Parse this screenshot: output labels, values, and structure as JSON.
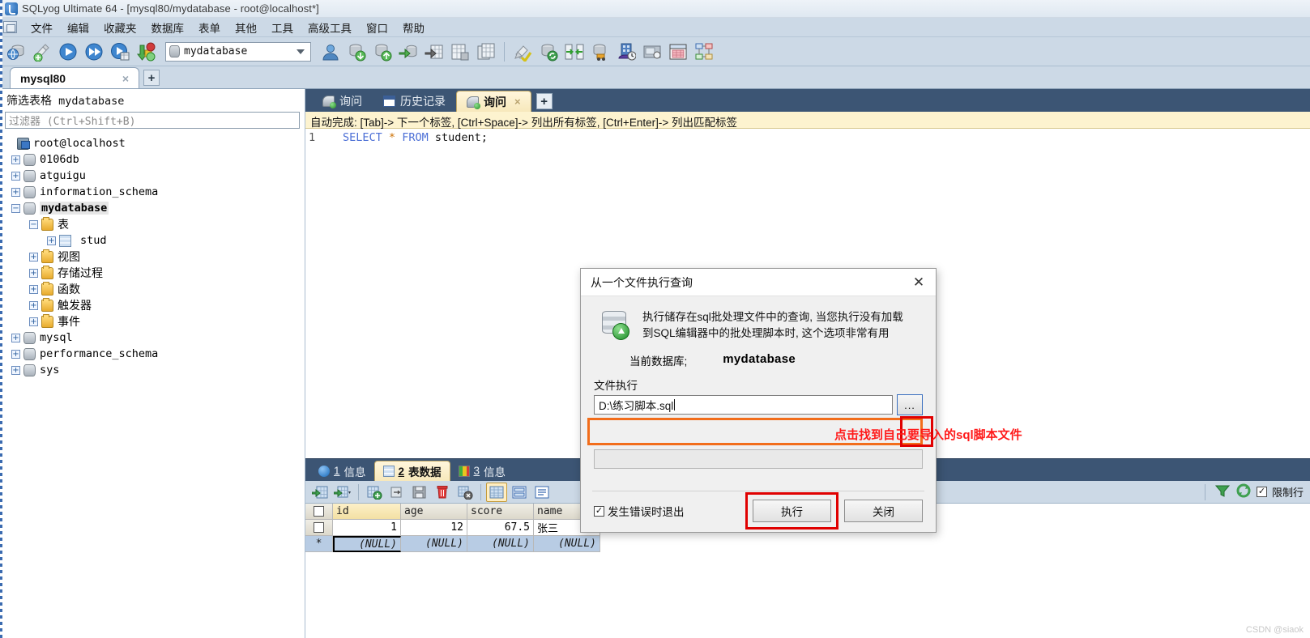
{
  "window": {
    "title": "SQLyog Ultimate 64 - [mysql80/mydatabase - root@localhost*]",
    "icon": "sqlyog-logo-icon"
  },
  "menubar": {
    "items": [
      "文件",
      "编辑",
      "收藏夹",
      "数据库",
      "表单",
      "其他",
      "工具",
      "高级工具",
      "窗口",
      "帮助"
    ]
  },
  "toolbar": {
    "db_selector_value": "mydatabase",
    "buttons": [
      "new-connection-icon",
      "refresh-object-icon",
      "execute-query-icon",
      "execute-all-queries-icon",
      "execute-query-current-icon",
      "import-export-icon"
    ],
    "buttons_right": [
      "user-manager-icon",
      "backup-database-icon",
      "restore-database-icon",
      "import-external-data-icon",
      "export-table-data-icon",
      "table-diagnostics-icon",
      "schema-designer-icon",
      "copy-database-icon",
      "sync-database-icon",
      "compare-data-icon",
      "migration-icon",
      "scheduled-backup-icon",
      "notification-services-icon",
      "form-view-icon",
      "schema-sync-icon"
    ]
  },
  "connection_tabs": {
    "tabs": [
      {
        "label": "mysql80",
        "active": true,
        "close": "×"
      }
    ],
    "add_label": "+"
  },
  "sidebar": {
    "header_prefix": "筛选表格",
    "header_db": "mydatabase",
    "filter_placeholder": "过滤器 (Ctrl+Shift+B)",
    "tree": [
      {
        "label": "root@localhost",
        "icon": "server-icon",
        "indent": 0,
        "expander": "",
        "bold": false
      },
      {
        "label": "0106db",
        "icon": "database-icon",
        "indent": 1,
        "expander": "+",
        "bold": false
      },
      {
        "label": "atguigu",
        "icon": "database-icon",
        "indent": 1,
        "expander": "+",
        "bold": false
      },
      {
        "label": "information_schema",
        "icon": "database-icon",
        "indent": 1,
        "expander": "+",
        "bold": false
      },
      {
        "label": "mydatabase",
        "icon": "database-icon",
        "indent": 1,
        "expander": "−",
        "bold": true
      },
      {
        "label": "表",
        "icon": "folder-icon",
        "indent": 2,
        "expander": "−",
        "bold": false,
        "cjk": true
      },
      {
        "label": "stud",
        "icon": "table-icon",
        "indent": 3,
        "expander": "+",
        "bold": false
      },
      {
        "label": "视图",
        "icon": "folder-icon",
        "indent": 2,
        "expander": "+",
        "bold": false,
        "cjk": true
      },
      {
        "label": "存储过程",
        "icon": "folder-icon",
        "indent": 2,
        "expander": "+",
        "bold": false,
        "cjk": true
      },
      {
        "label": "函数",
        "icon": "folder-icon",
        "indent": 2,
        "expander": "+",
        "bold": false,
        "cjk": true
      },
      {
        "label": "触发器",
        "icon": "folder-icon",
        "indent": 2,
        "expander": "+",
        "bold": false,
        "cjk": true
      },
      {
        "label": "事件",
        "icon": "folder-icon",
        "indent": 2,
        "expander": "+",
        "bold": false,
        "cjk": true
      },
      {
        "label": "mysql",
        "icon": "database-icon",
        "indent": 1,
        "expander": "+",
        "bold": false
      },
      {
        "label": "performance_schema",
        "icon": "database-icon",
        "indent": 1,
        "expander": "+",
        "bold": false
      },
      {
        "label": "sys",
        "icon": "database-icon",
        "indent": 1,
        "expander": "+",
        "bold": false
      }
    ]
  },
  "query_tabs": {
    "tabs": [
      {
        "label": "询问",
        "icon": "query-icon",
        "active": false,
        "closable": false
      },
      {
        "label": "历史记录",
        "icon": "history-icon",
        "active": false,
        "closable": false
      },
      {
        "label": "询问",
        "icon": "query-icon",
        "active": true,
        "closable": true,
        "close": "×"
      }
    ],
    "add_label": "+"
  },
  "editor": {
    "autocomplete_hint": "自动完成: [Tab]-> 下一个标签, [Ctrl+Space]-> 列出所有标签, [Ctrl+Enter]-> 列出匹配标签",
    "line_number": "1",
    "sql_keyword1": "SELECT",
    "sql_star": "*",
    "sql_keyword2": "FROM",
    "sql_rest": "student;"
  },
  "results": {
    "tabs": [
      {
        "num": "1",
        "label": "信息",
        "icon": "info-icon",
        "active": false
      },
      {
        "num": "2",
        "label": "表数据",
        "icon": "grid-icon",
        "active": true
      },
      {
        "num": "3",
        "label": "信息",
        "icon": "chart-icon",
        "active": false
      }
    ],
    "toolbar_icons": [
      "insert-row-icon",
      "insert-row-dropdown-icon",
      "duplicate-row-icon",
      "add-record-icon",
      "refresh-data-icon",
      "save-changes-icon",
      "delete-row-icon",
      "discard-changes-icon",
      "grid-view-icon",
      "form-view-icon",
      "text-view-icon"
    ],
    "right_icons": [
      "filter-icon",
      "refresh-icon"
    ],
    "limit_label": "限制行",
    "grid": {
      "columns": [
        "id",
        "age",
        "score",
        "name"
      ],
      "key_column": "id",
      "rows": [
        {
          "id": "1",
          "age": "12",
          "score": "67.5",
          "name": "张三"
        }
      ],
      "new_row": {
        "id": "(NULL)",
        "age": "(NULL)",
        "score": "(NULL)",
        "name": "(NULL)",
        "marker": "*"
      }
    }
  },
  "dialog": {
    "title": "从一个文件执行查询",
    "close_glyph": "✕",
    "icon": "execute-sql-file-icon",
    "description_line1": "执行储存在sql批处理文件中的查询, 当您执行没有加载",
    "description_line2": "到SQL编辑器中的批处理脚本时, 这个选项非常有用",
    "current_db_label": "当前数据库;",
    "current_db_value": "mydatabase",
    "file_section_label": "文件执行",
    "file_path": "D:\\练习脚本.sql",
    "browse_label": "...",
    "checkbox_label": "发生错误时退出",
    "checkbox_checked": true,
    "execute_label": "执行",
    "close_label": "关闭"
  },
  "annotation": {
    "text": "点击找到自己要导入的sql脚本文件",
    "color": "#ff1a1a"
  },
  "watermark": "CSDN @siaok",
  "colors": {
    "toolbar_bg": "#ccd9e6",
    "tab_strip_bg": "#3c5574",
    "active_tab_bg": "#fdf0c8",
    "autocomplete_bg": "#fdf3cf",
    "highlight_orange": "#f26d1b",
    "highlight_red": "#e00000"
  }
}
